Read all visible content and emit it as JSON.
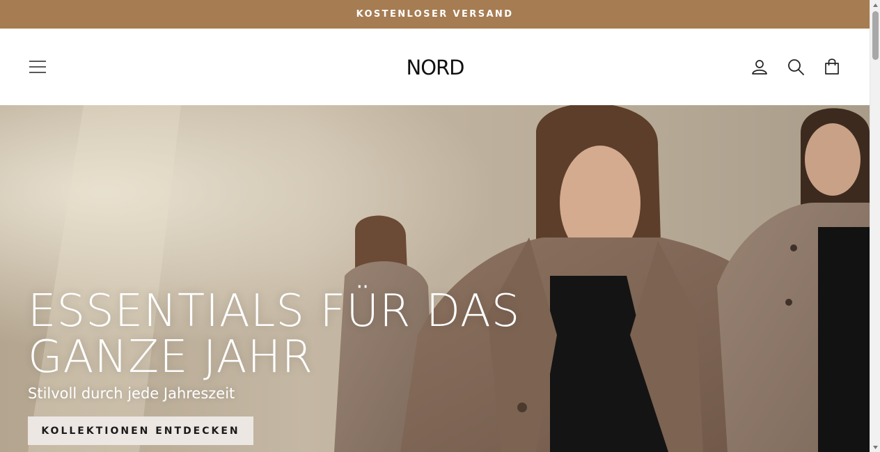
{
  "announcement": {
    "text": "KOSTENLOSER VERSAND",
    "bg_color": "#a67c52"
  },
  "header": {
    "logo": "NORD",
    "icons": {
      "menu": "hamburger-icon",
      "account": "user-icon",
      "search": "search-icon",
      "cart": "shopping-bag-icon"
    }
  },
  "hero": {
    "title": "ESSENTIALS FÜR DAS GANZE JAHR",
    "subtitle": "Stilvoll durch jede Jahreszeit",
    "cta_label": "KOLLEKTIONEN ENTDECKEN",
    "image": "three-women-in-brown-wool-coats"
  },
  "colors": {
    "accent": "#a67c52",
    "coat": "#8a6f5d",
    "background": "#c9bba6"
  }
}
